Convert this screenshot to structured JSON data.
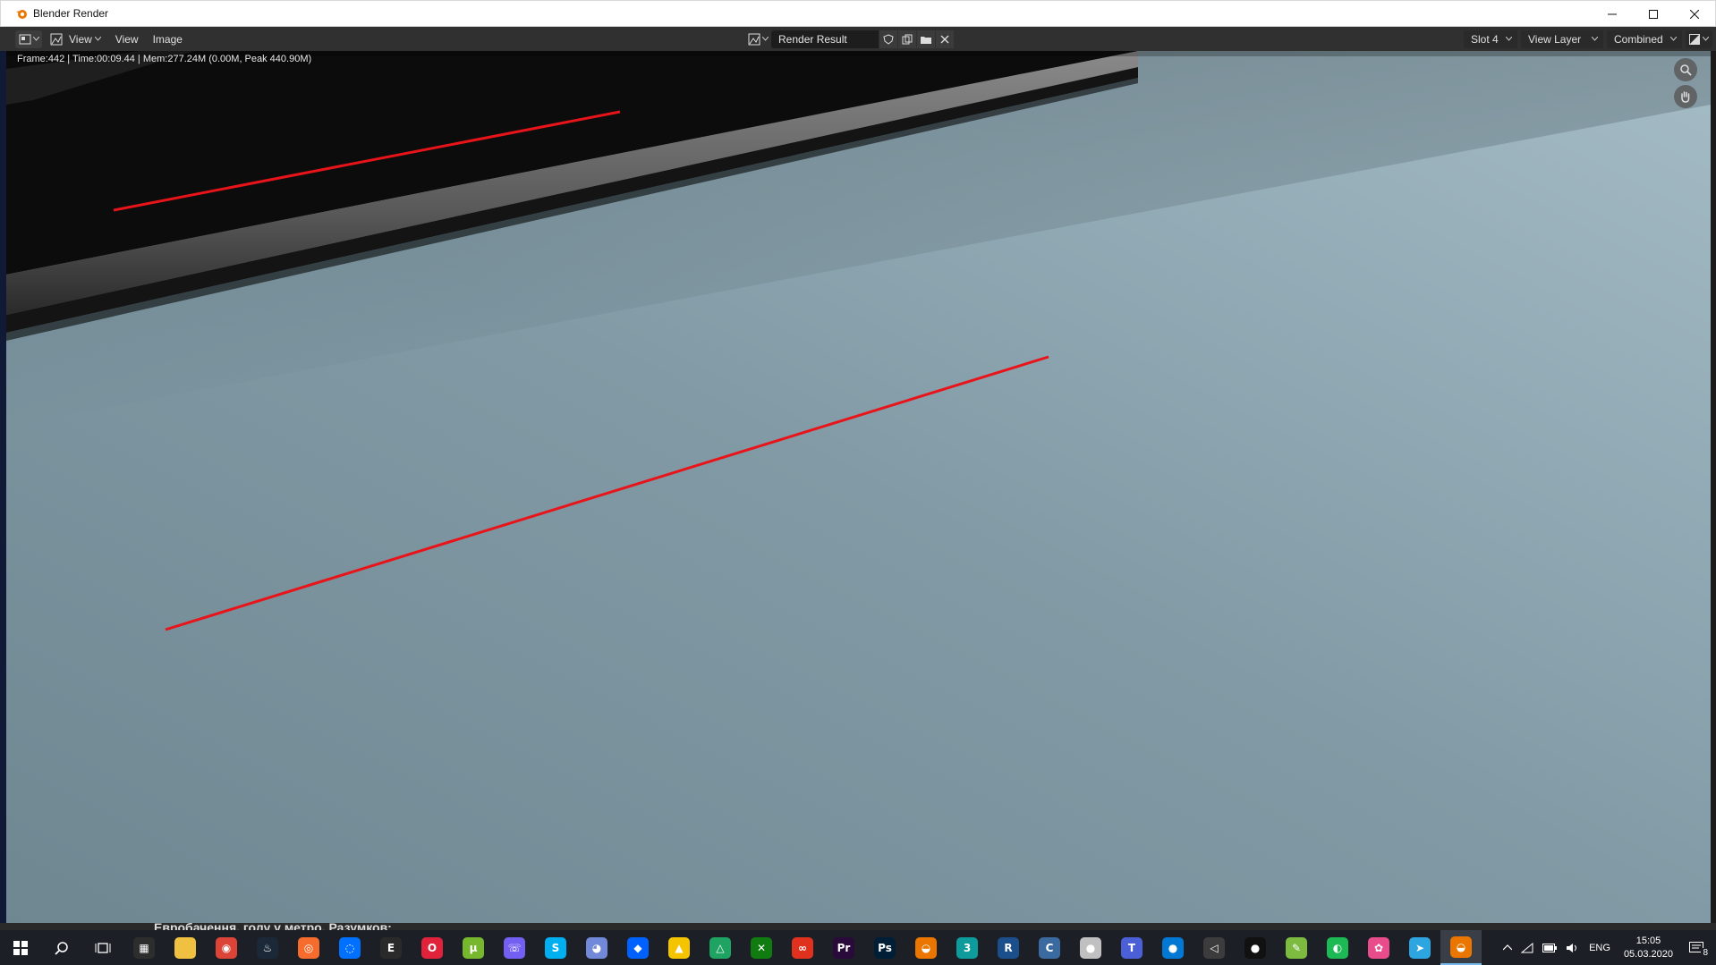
{
  "window": {
    "title": "Blender Render"
  },
  "header": {
    "menus": [
      "View",
      "View",
      "Image"
    ],
    "image_name": "Render Result",
    "slot": "Slot 4",
    "view_layer": "View Layer",
    "pass": "Combined"
  },
  "viewport": {
    "info": "Frame:442 | Time:00:09.44 | Mem:277.24M (0.00M, Peak 440.90M)",
    "annotation_color": "#e8141a"
  },
  "behind_window_text": "Евробачення, голу у метро, Разумков:",
  "taskbar": {
    "apps": [
      {
        "icon": "calculator-icon",
        "color": "#2d2d2d",
        "glyph": "▦"
      },
      {
        "icon": "file-explorer-icon",
        "color": "#f0c040",
        "glyph": ""
      },
      {
        "icon": "chrome-icon",
        "color": "#db4437",
        "glyph": "◉"
      },
      {
        "icon": "steam-icon",
        "color": "#1b2838",
        "glyph": "♨"
      },
      {
        "icon": "origin-icon",
        "color": "#f56c2d",
        "glyph": "◎"
      },
      {
        "icon": "uplay-icon",
        "color": "#0070ff",
        "glyph": "◌"
      },
      {
        "icon": "epic-games-icon",
        "color": "#2a2a2a",
        "glyph": "E"
      },
      {
        "icon": "opera-icon",
        "color": "#e0233a",
        "glyph": "O"
      },
      {
        "icon": "utorrent-icon",
        "color": "#77b72d",
        "glyph": "µ"
      },
      {
        "icon": "viber-icon",
        "color": "#7360f2",
        "glyph": "☏"
      },
      {
        "icon": "skype-icon",
        "color": "#00aff0",
        "glyph": "S"
      },
      {
        "icon": "discord-icon",
        "color": "#7289da",
        "glyph": "◕"
      },
      {
        "icon": "dropbox-icon",
        "color": "#0061fe",
        "glyph": "◆"
      },
      {
        "icon": "warning-app-icon",
        "color": "#f5c400",
        "glyph": "▲"
      },
      {
        "icon": "google-drive-icon",
        "color": "#1ea362",
        "glyph": "△"
      },
      {
        "icon": "xbox-icon",
        "color": "#107c10",
        "glyph": "✕"
      },
      {
        "icon": "creative-cloud-icon",
        "color": "#e0301e",
        "glyph": "∞"
      },
      {
        "icon": "premiere-icon",
        "color": "#2a0a3a",
        "glyph": "Pr"
      },
      {
        "icon": "photoshop-icon",
        "color": "#001e36",
        "glyph": "Ps"
      },
      {
        "icon": "blender-icon",
        "color": "#ea7600",
        "glyph": "◒"
      },
      {
        "icon": "3dsmax-icon",
        "color": "#0d9b9b",
        "glyph": "3"
      },
      {
        "icon": "revit-icon",
        "color": "#1a4f8b",
        "glyph": "R"
      },
      {
        "icon": "ccleaner-icon",
        "color": "#3a6aa0",
        "glyph": "C"
      },
      {
        "icon": "sphere-app-icon",
        "color": "#c0c0c0",
        "glyph": "●"
      },
      {
        "icon": "trello-icon",
        "color": "#4b5fd6",
        "glyph": "T"
      },
      {
        "icon": "maps-icon",
        "color": "#0078d4",
        "glyph": "●"
      },
      {
        "icon": "visual-studio-icon",
        "color": "#3c3c3c",
        "glyph": "◁"
      },
      {
        "icon": "record-icon",
        "color": "#111111",
        "glyph": "●"
      },
      {
        "icon": "notepad-icon",
        "color": "#7cbb3f",
        "glyph": "✎"
      },
      {
        "icon": "evernote-icon",
        "color": "#1db954",
        "glyph": "◐"
      },
      {
        "icon": "picasa-icon",
        "color": "#e94c8a",
        "glyph": "✿"
      },
      {
        "icon": "telegram-icon",
        "color": "#2ca5e0",
        "glyph": "➤"
      },
      {
        "icon": "blender-active-icon",
        "color": "#ea7600",
        "glyph": "◒"
      }
    ],
    "language": "ENG",
    "time": "15:05",
    "date": "05.03.2020",
    "notifications": "8"
  }
}
